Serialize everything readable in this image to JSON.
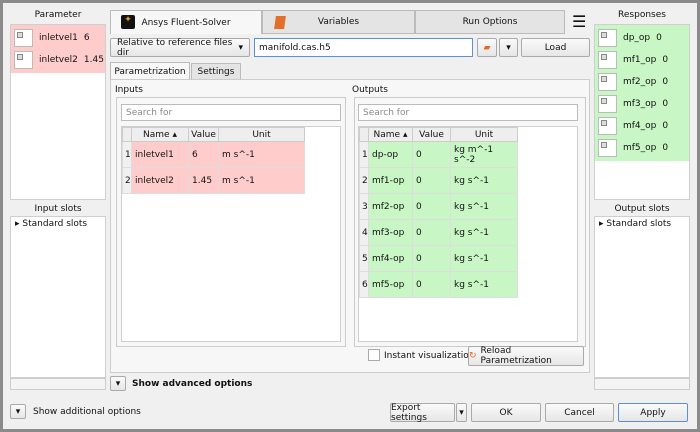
{
  "parameter_panel": {
    "title": "Parameter",
    "items": [
      {
        "name": "inletvel1",
        "value": "6"
      },
      {
        "name": "inletvel2",
        "value": "1.45"
      }
    ],
    "slots_title": "Input slots",
    "slots_tree": "Standard slots"
  },
  "responses_panel": {
    "title": "Responses",
    "items": [
      {
        "name": "dp_op",
        "value": "0"
      },
      {
        "name": "mf1_op",
        "value": "0"
      },
      {
        "name": "mf2_op",
        "value": "0"
      },
      {
        "name": "mf3_op",
        "value": "0"
      },
      {
        "name": "mf4_op",
        "value": "0"
      },
      {
        "name": "mf5_op",
        "value": "0"
      }
    ],
    "slots_title": "Output slots",
    "slots_tree": "Standard slots"
  },
  "tabs": [
    "Ansys Fluent-Solver",
    "Variables",
    "Run Options"
  ],
  "file_row": {
    "mode": "Relative to reference files dir",
    "file": "manifold.cas.h5",
    "load": "Load"
  },
  "subtabs": [
    "Parametrization",
    "Settings"
  ],
  "inputs": {
    "title": "Inputs",
    "search_placeholder": "Search for",
    "headers": [
      "Name",
      "Value",
      "Unit"
    ],
    "rows": [
      {
        "n": "1",
        "name": "inletvel1",
        "value": "6",
        "unit": "m s^-1"
      },
      {
        "n": "2",
        "name": "inletvel2",
        "value": "1.45",
        "unit": "m s^-1"
      }
    ]
  },
  "outputs": {
    "title": "Outputs",
    "search_placeholder": "Search for",
    "headers": [
      "Name",
      "Value",
      "Unit"
    ],
    "rows": [
      {
        "n": "1",
        "name": "dp-op",
        "value": "0",
        "unit": "kg m^-1 s^-2"
      },
      {
        "n": "2",
        "name": "mf1-op",
        "value": "0",
        "unit": "kg s^-1"
      },
      {
        "n": "3",
        "name": "mf2-op",
        "value": "0",
        "unit": "kg s^-1"
      },
      {
        "n": "4",
        "name": "mf3-op",
        "value": "0",
        "unit": "kg s^-1"
      },
      {
        "n": "5",
        "name": "mf4-op",
        "value": "0",
        "unit": "kg s^-1"
      },
      {
        "n": "6",
        "name": "mf5-op",
        "value": "0",
        "unit": "kg s^-1"
      }
    ]
  },
  "instant_visualization": "Instant visualization",
  "reload": "Reload Parametrization",
  "advanced": "Show advanced options",
  "additional": "Show additional options",
  "buttons": {
    "export": "Export settings",
    "ok": "OK",
    "cancel": "Cancel",
    "apply": "Apply"
  },
  "colors": {
    "input_bg": "#ffcccc",
    "output_bg": "#c8f7c5",
    "accent": "#e8641b"
  }
}
